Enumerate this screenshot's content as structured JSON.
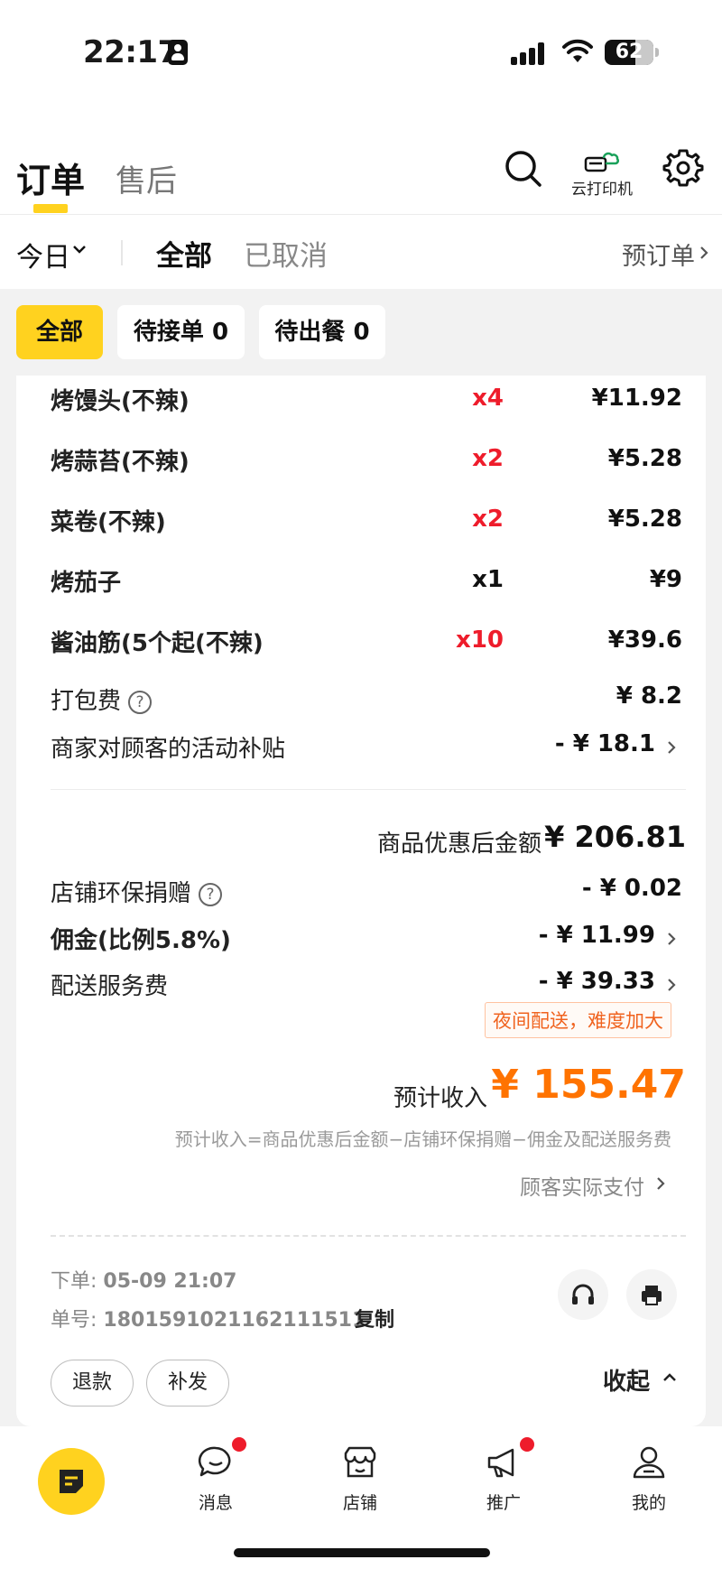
{
  "status_bar": {
    "time": "22:17",
    "battery": "62"
  },
  "header": {
    "tab_active": "订单",
    "tab_other": "售后",
    "printer_label": "云打印机"
  },
  "filter": {
    "date": "今日",
    "all": "全部",
    "cancelled": "已取消",
    "preorder": "预订单"
  },
  "chips": {
    "all": "全部",
    "pending_accept": "待接单 0",
    "pending_meal": "待出餐 0"
  },
  "items": [
    {
      "name": "烤馒头(不辣)",
      "qty": "x4",
      "price": "¥11.92",
      "qty_color": "red"
    },
    {
      "name": "烤蒜苔(不辣)",
      "qty": "x2",
      "price": "¥5.28",
      "qty_color": "red"
    },
    {
      "name": "菜卷(不辣)",
      "qty": "x2",
      "price": "¥5.28",
      "qty_color": "red"
    },
    {
      "name": "烤茄子",
      "qty": "x1",
      "price": "¥9",
      "qty_color": "black"
    },
    {
      "name": "酱油筋(5个起(不辣)",
      "qty": "x10",
      "price": "¥39.6",
      "qty_color": "red"
    }
  ],
  "fees": {
    "packing_label": "打包费",
    "packing_value": "¥ 8.2",
    "subsidy_label": "商家对顾客的活动补贴",
    "subsidy_value": "- ¥ 18.1"
  },
  "subtotal": {
    "label": "商品优惠后金额",
    "value": "¥ 206.81"
  },
  "deductions": {
    "eco_label": "店铺环保捐赠",
    "eco_value": "- ¥ 0.02",
    "commission_label": "佣金(比例5.8%)",
    "commission_value": "- ¥ 11.99",
    "delivery_label": "配送服务费",
    "delivery_value": "- ¥ 39.33",
    "night_badge": "夜间配送，难度加大"
  },
  "income": {
    "label": "预计收入",
    "value": "¥ 155.47",
    "formula": "预计收入=商品优惠后金额−店铺环保捐赠−佣金及配送服务费",
    "actual_pay": "顾客实际支付"
  },
  "order": {
    "time_label": "下单: ",
    "time_value": "05-09 21:07",
    "no_label": "单号: ",
    "no_value": "1801591021162111511",
    "copy": "复制",
    "refund": "退款",
    "resend": "补发",
    "collapse": "收起"
  },
  "bottom_nav": {
    "messages": "消息",
    "store": "店铺",
    "promote": "推广",
    "mine": "我的"
  },
  "colors": {
    "accent": "#ffd21f",
    "income": "#ff7300",
    "qty_red": "#ee1c2b"
  }
}
